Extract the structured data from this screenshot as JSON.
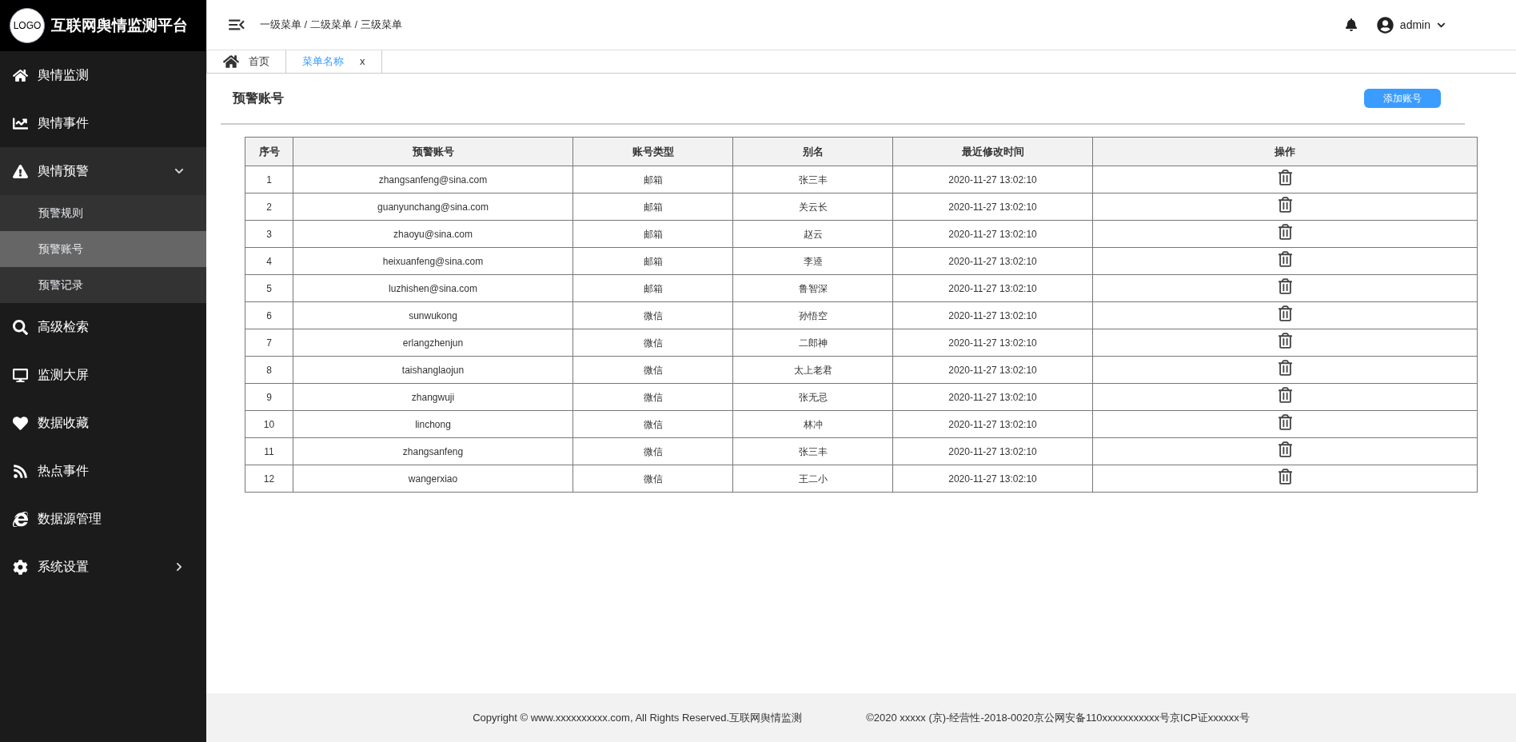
{
  "brand": {
    "logo": "LOGO",
    "title": "互联网舆情监测平台"
  },
  "sidebar": {
    "items": [
      {
        "label": "舆情监测",
        "selected": false
      },
      {
        "label": "舆情事件",
        "selected": false
      },
      {
        "label": "舆情预警",
        "selected": false,
        "expanded": true,
        "children": [
          {
            "label": "预警规则",
            "selected": false
          },
          {
            "label": "预警账号",
            "selected": true
          },
          {
            "label": "预警记录",
            "selected": false
          }
        ]
      },
      {
        "label": "高级检索",
        "selected": false
      },
      {
        "label": "监测大屏",
        "selected": false
      },
      {
        "label": "数据收藏",
        "selected": false
      },
      {
        "label": "热点事件",
        "selected": false
      },
      {
        "label": "数据源管理",
        "selected": false
      },
      {
        "label": "系统设置",
        "selected": false,
        "expanded": false
      }
    ]
  },
  "header": {
    "breadcrumb": "一级菜单 / 二级菜单 / 三级菜单",
    "user": "admin"
  },
  "tabs": [
    {
      "label": "首页",
      "kind": "home",
      "selected": false
    },
    {
      "label": "菜单名称",
      "kind": "page",
      "close": "x",
      "selected": true
    }
  ],
  "page": {
    "title": "预警账号",
    "add_button": "添加账号"
  },
  "table": {
    "columns": [
      "序号",
      "预警账号",
      "账号类型",
      "别名",
      "最近修改时间",
      "操作"
    ],
    "rows": [
      [
        "1",
        "zhangsanfeng@sina.com",
        "邮箱",
        "张三丰",
        "2020-11-27 13:02:10"
      ],
      [
        "2",
        "guanyunchang@sina.com",
        "邮箱",
        "关云长",
        "2020-11-27 13:02:10"
      ],
      [
        "3",
        "zhaoyu@sina.com",
        "邮箱",
        "赵云",
        "2020-11-27 13:02:10"
      ],
      [
        "4",
        "heixuanfeng@sina.com",
        "邮箱",
        "李逵",
        "2020-11-27 13:02:10"
      ],
      [
        "5",
        "luzhishen@sina.com",
        "邮箱",
        "鲁智深",
        "2020-11-27 13:02:10"
      ],
      [
        "6",
        "sunwukong",
        "微信",
        "孙悟空",
        "2020-11-27 13:02:10"
      ],
      [
        "7",
        "erlangzhenjun",
        "微信",
        "二郎神",
        "2020-11-27 13:02:10"
      ],
      [
        "8",
        "taishanglaojun",
        "微信",
        "太上老君",
        "2020-11-27 13:02:10"
      ],
      [
        "9",
        "zhangwuji",
        "微信",
        "张无忌",
        "2020-11-27 13:02:10"
      ],
      [
        "10",
        "linchong",
        "微信",
        "林冲",
        "2020-11-27 13:02:10"
      ],
      [
        "11",
        "zhangsanfeng",
        "微信",
        "张三丰",
        "2020-11-27 13:02:10"
      ],
      [
        "12",
        "wangerxiao",
        "微信",
        "王二小",
        "2020-11-27 13:02:10"
      ]
    ]
  },
  "footer": {
    "copyright": "Copyright © www.xxxxxxxxxx.com, All Rights Reserved.互联网舆情监测",
    "license": "©2020 xxxxx (京)-经营性-2018-0020京公网安备110xxxxxxxxxxx号京ICP证xxxxxx号"
  }
}
